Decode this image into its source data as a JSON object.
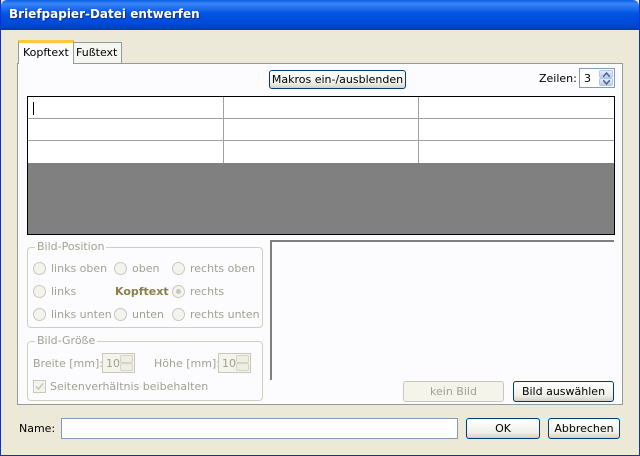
{
  "window": {
    "title": "Briefpapier-Datei entwerfen"
  },
  "tabs": [
    {
      "label": "Kopftext",
      "active": true
    },
    {
      "label": "Fußtext",
      "active": false
    }
  ],
  "toolbar": {
    "macros_button": "Makros ein-/ausblenden",
    "rows_label": "Zeilen:",
    "rows_value": "3"
  },
  "image_position": {
    "title": "Bild-Position",
    "options": {
      "top_left": "links oben",
      "top": "oben",
      "top_right": "rechts oben",
      "left": "links",
      "right": "rechts",
      "bottom_left": "links unten",
      "bottom": "unten",
      "bottom_right": "rechts unten"
    },
    "center_label": "Kopftext",
    "selected": "right"
  },
  "image_size": {
    "title": "Bild-Größe",
    "width_label": "Breite [mm]:",
    "width_value": "10",
    "height_label": "Höhe [mm]:",
    "height_value": "10",
    "keep_ratio_label": "Seitenverhältnis beibehalten",
    "keep_ratio_checked": true
  },
  "image_buttons": {
    "no_image": "kein Bild",
    "choose_image": "Bild auswählen"
  },
  "footer": {
    "name_label": "Name:",
    "name_value": "",
    "ok": "OK",
    "cancel": "Abbrechen"
  }
}
